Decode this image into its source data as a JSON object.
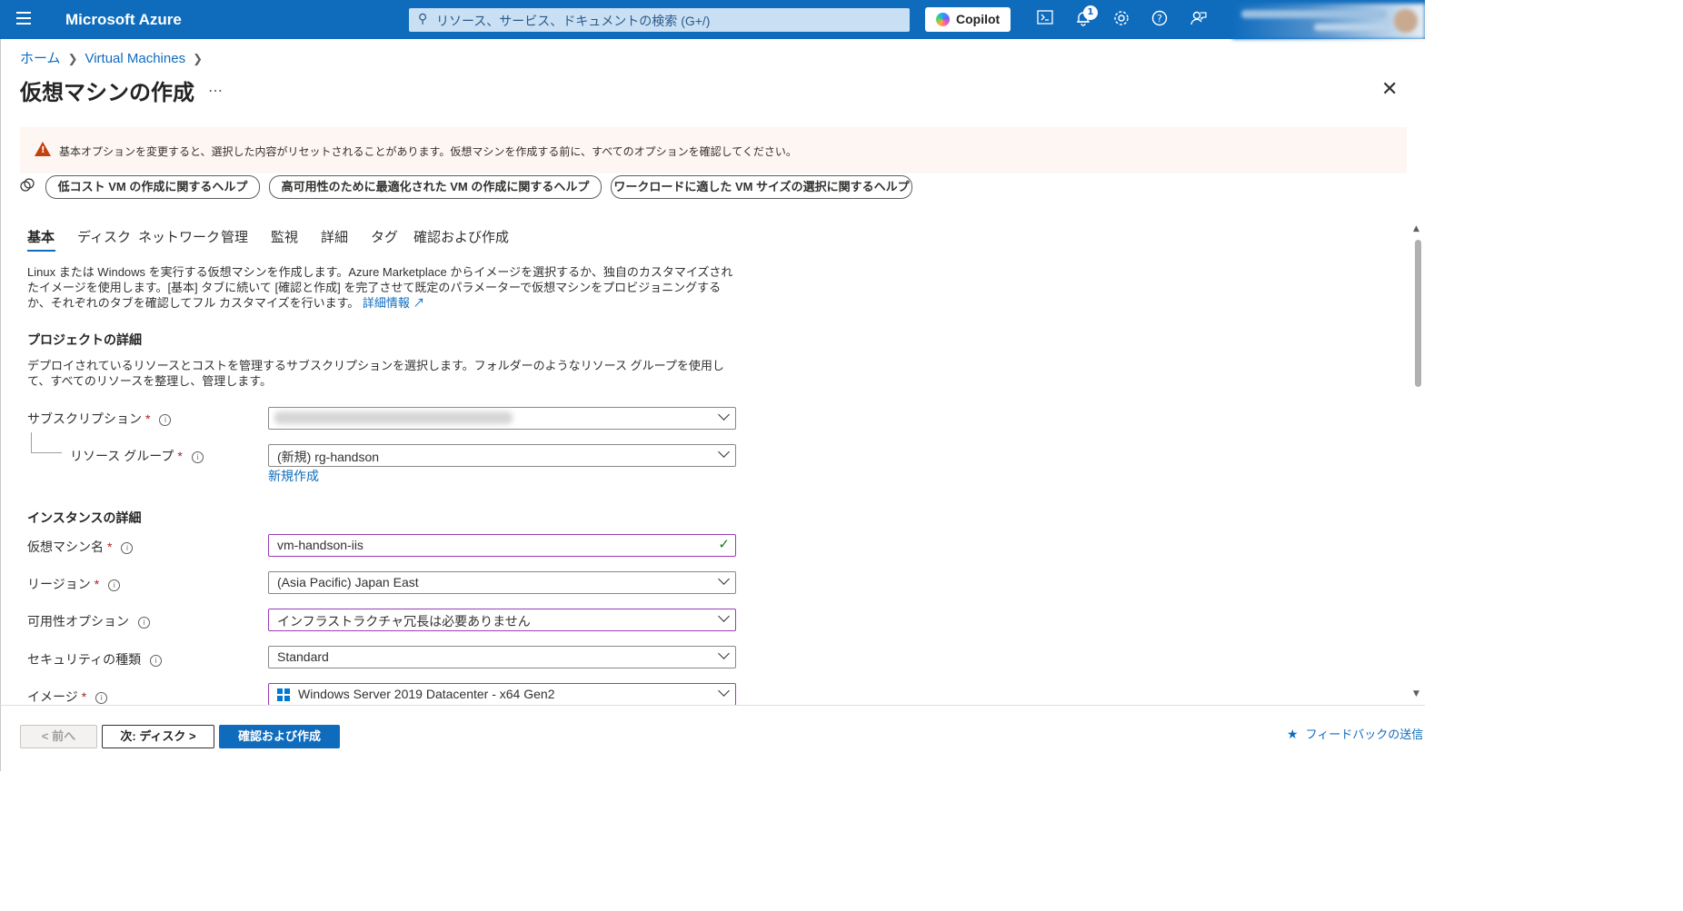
{
  "topbar": {
    "brand": "Microsoft Azure",
    "search_placeholder": "リソース、サービス、ドキュメントの検索 (G+/)",
    "copilot_label": "Copilot",
    "notification_count": "1",
    "accent_color": "#0f6cbd"
  },
  "breadcrumb": {
    "home": "ホーム",
    "vm": "Virtual Machines"
  },
  "page": {
    "title": "仮想マシンの作成",
    "more": "…"
  },
  "warning": {
    "text": "基本オプションを変更すると、選択した内容がリセットされることがあります。仮想マシンを作成する前に、すべてのオプションを確認してください。"
  },
  "help_buttons": [
    "低コスト VM の作成に関するヘルプ",
    "高可用性のために最適化された VM の作成に関するヘルプ",
    "ワークロードに適した VM サイズの選択に関するヘルプ"
  ],
  "tabs": [
    "基本",
    "ディスク",
    "ネットワーク",
    "管理",
    "監視",
    "詳細",
    "タグ",
    "確認および作成"
  ],
  "intro": {
    "text": "Linux または Windows を実行する仮想マシンを作成します。Azure Marketplace からイメージを選択するか、独自のカスタマイズされたイメージを使用します。[基本] タブに続いて [確認と作成] を完了させて既定のパラメーターで仮想マシンをプロビジョニングするか、それぞれのタブを確認してフル カスタマイズを行います。",
    "link": "詳細情報"
  },
  "project": {
    "heading": "プロジェクトの詳細",
    "description": "デプロイされているリソースとコストを管理するサブスクリプションを選択します。フォルダーのようなリソース グループを使用して、すべてのリソースを整理し、管理します。",
    "subscription_label": "サブスクリプション",
    "resource_group_label": "リソース グループ",
    "resource_group_value": "(新規) rg-handson",
    "new_link": "新規作成"
  },
  "instance": {
    "heading": "インスタンスの詳細",
    "vm_name_label": "仮想マシン名",
    "vm_name_value": "vm-handson-iis",
    "region_label": "リージョン",
    "region_value": "(Asia Pacific) Japan East",
    "availability_label": "可用性オプション",
    "availability_value": "インフラストラクチャ冗長は必要ありません",
    "security_label": "セキュリティの種類",
    "security_value": "Standard",
    "image_label": "イメージ",
    "image_value": "Windows Server 2019 Datacenter - x64 Gen2"
  },
  "footer": {
    "prev": "< 前へ",
    "next": "次: ディスク >",
    "review": "確認および作成",
    "feedback": "フィードバックの送信"
  }
}
